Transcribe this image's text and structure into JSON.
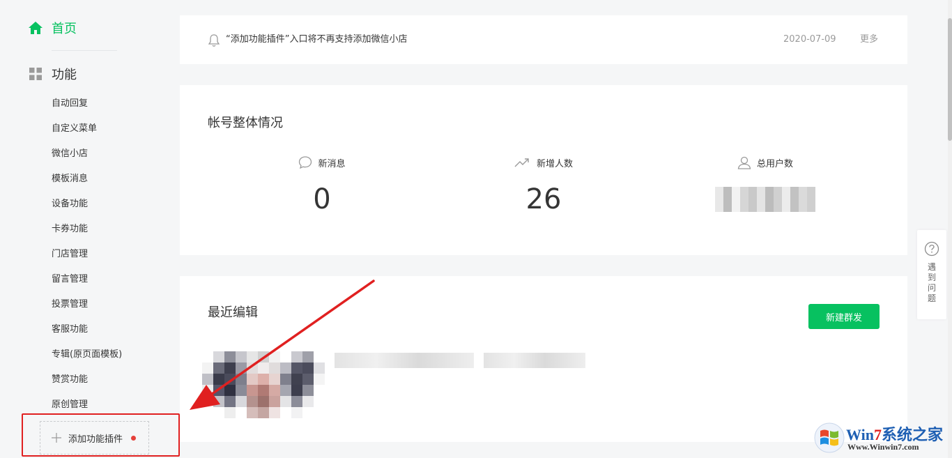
{
  "sidebar": {
    "home_label": "首页",
    "function_label": "功能",
    "menu": [
      "自动回复",
      "自定义菜单",
      "微信小店",
      "模板消息",
      "设备功能",
      "卡券功能",
      "门店管理",
      "留言管理",
      "投票管理",
      "客服功能",
      "专辑(原页面模板)",
      "赞赏功能",
      "原创管理"
    ],
    "add_plugin_label": "添加功能插件"
  },
  "notice": {
    "text": "“添加功能插件”入口将不再支持添加微信小店",
    "date": "2020-07-09",
    "more": "更多"
  },
  "stats": {
    "title": "帐号整体情况",
    "new_messages_label": "新消息",
    "new_messages_value": "0",
    "new_followers_label": "新增人数",
    "new_followers_value": "26",
    "total_users_label": "总用户数"
  },
  "recent": {
    "title": "最近编辑",
    "new_mass_button": "新建群发"
  },
  "help": {
    "label": "遇到问题"
  },
  "watermark": {
    "brand_prefix": "Win",
    "brand_seven": "7",
    "brand_suffix": "系统之家",
    "url": "Www.Winwin7.com"
  },
  "colors": {
    "accent": "#07c160",
    "annotation": "#e02020",
    "background": "#f5f6f7",
    "card": "#ffffff"
  }
}
